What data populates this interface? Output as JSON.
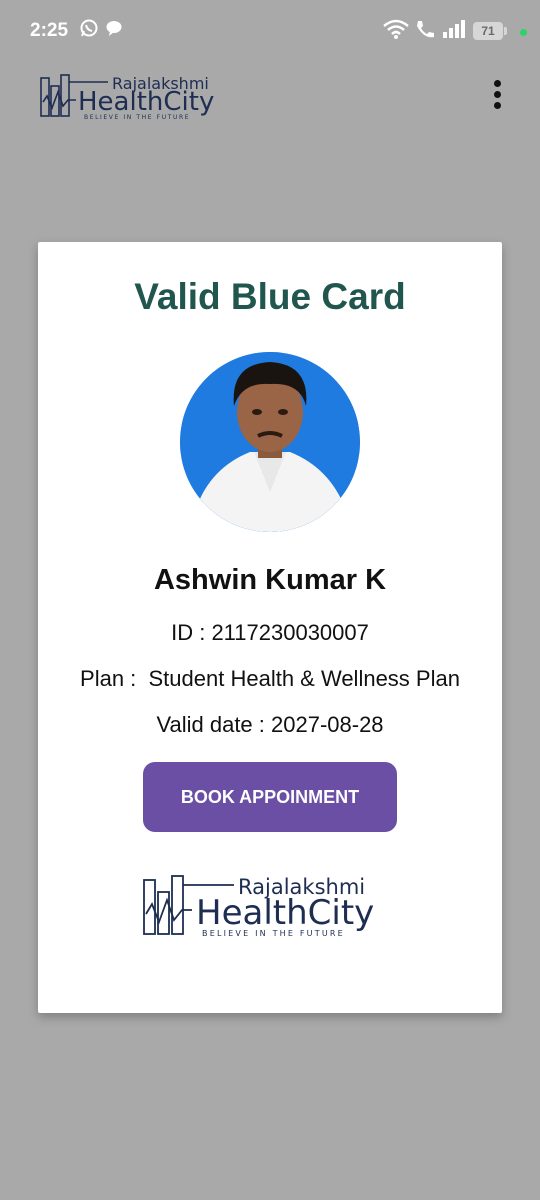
{
  "status_bar": {
    "time": "2:25",
    "battery_level": "71",
    "icons": [
      "whatsapp-icon",
      "chat-icon",
      "wifi-icon",
      "call-icon",
      "signal-icon",
      "battery-icon"
    ]
  },
  "app_bar": {
    "logo": {
      "line1": "Rajalakshmi",
      "line2": "HealthCity",
      "tagline": "BELIEVE IN THE FUTURE"
    },
    "menu_icon": "more-vertical-icon"
  },
  "card": {
    "title": "Valid Blue Card",
    "name": "Ashwin Kumar K",
    "id_line": "ID : 2117230030007",
    "plan_line": "Plan :  Student Health & Wellness Plan",
    "valid_line": "Valid date : 2027-08-28",
    "button_label": "BOOK APPOINMENT",
    "logo": {
      "line1": "Rajalakshmi",
      "line2": "HealthCity",
      "tagline": "BELIEVE IN THE FUTURE"
    }
  },
  "colors": {
    "background": "#a9a9a9",
    "title": "#21564f",
    "button": "#6a4fa5",
    "logo": "#1e2d52",
    "avatar_bg": "#1f7be0"
  }
}
